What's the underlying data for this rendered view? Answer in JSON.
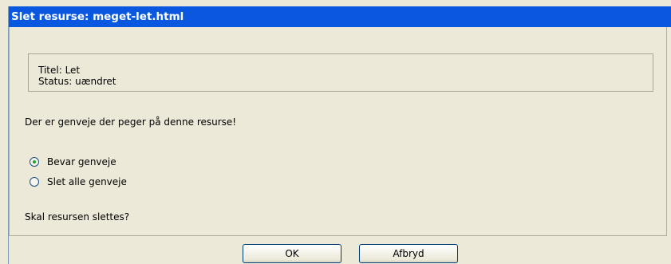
{
  "dialog": {
    "title": "Slet resurse: meget-let.html"
  },
  "info": {
    "title_line": "Titel: Let",
    "status_line": "Status: uændret"
  },
  "message": "Der er genveje der peger på denne resurse!",
  "options": [
    {
      "label": "Bevar genveje",
      "selected": true
    },
    {
      "label": "Slet alle genveje",
      "selected": false
    }
  ],
  "question": "Skal resursen slettes?",
  "buttons": {
    "ok": "OK",
    "cancel": "Afbryd"
  },
  "colors": {
    "titlebar": "#0a57e0",
    "background": "#ece9d8",
    "radio_dot": "#21a121"
  }
}
